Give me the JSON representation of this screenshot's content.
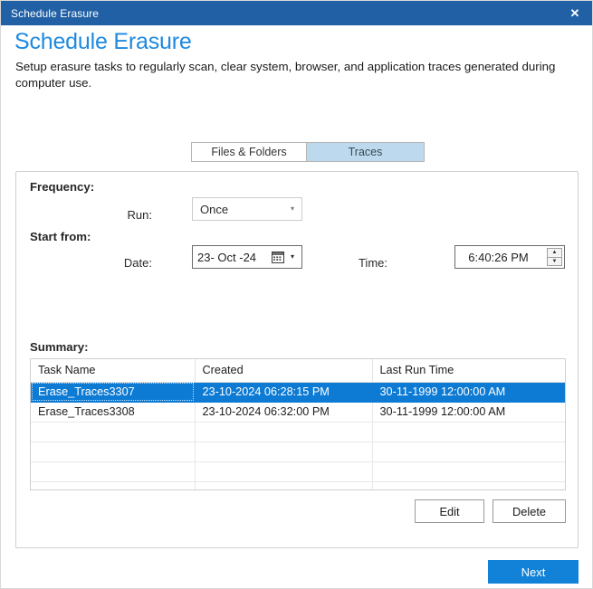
{
  "window": {
    "title": "Schedule Erasure",
    "close_label": "✕"
  },
  "header": {
    "title": "Schedule Erasure",
    "description": "Setup erasure tasks to regularly scan, clear system, browser, and application traces generated during computer use."
  },
  "tabs": [
    {
      "label": "Files & Folders",
      "selected": false
    },
    {
      "label": "Traces",
      "selected": true
    }
  ],
  "frequency": {
    "section_label": "Frequency:",
    "run_label": "Run:",
    "run_value": "Once",
    "run_options": [
      "Once"
    ],
    "dropdown_arrow": "▾"
  },
  "start_from": {
    "section_label": "Start from:",
    "date_label": "Date:",
    "date_value": "23- Oct -24",
    "date_dropdown_arrow": "▾",
    "time_label": "Time:",
    "time_value": "6:40:26 PM",
    "spin_up": "▲",
    "spin_down": "▼"
  },
  "summary": {
    "section_label": "Summary:",
    "columns": [
      "Task Name",
      "Created",
      "Last Run Time"
    ],
    "rows": [
      {
        "task_name": "Erase_Traces3307",
        "created": "23-10-2024 06:28:15 PM",
        "last_run_time": "30-11-1999 12:00:00 AM",
        "selected": true
      },
      {
        "task_name": "Erase_Traces3308",
        "created": "23-10-2024 06:32:00 PM",
        "last_run_time": "30-11-1999 12:00:00 AM",
        "selected": false
      },
      {
        "task_name": "",
        "created": "",
        "last_run_time": "",
        "selected": false
      },
      {
        "task_name": "",
        "created": "",
        "last_run_time": "",
        "selected": false
      },
      {
        "task_name": "",
        "created": "",
        "last_run_time": "",
        "selected": false
      },
      {
        "task_name": "",
        "created": "",
        "last_run_time": "",
        "selected": false
      }
    ]
  },
  "actions": {
    "edit_label": "Edit",
    "delete_label": "Delete",
    "next_label": "Next"
  },
  "colors": {
    "titlebar": "#2260a5",
    "heading": "#1e8ae0",
    "tab_selected": "#bdd9ee",
    "row_selected": "#0d7bd4",
    "primary_button": "#1282d8"
  }
}
